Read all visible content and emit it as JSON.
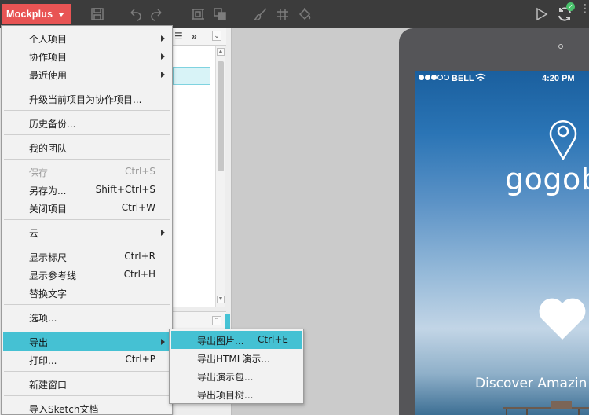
{
  "app": {
    "name": "Mockplus",
    "accent": "#e85454",
    "menu_highlight": "#45c1d3"
  },
  "toolbar": {
    "icons": [
      "save-icon",
      "undo-icon",
      "redo-icon",
      "crop-icon",
      "crop-group-icon",
      "brush-icon",
      "grid-icon",
      "paint-bucket-icon"
    ],
    "right_icons": [
      "play-icon",
      "sync-icon"
    ],
    "sync_badge": "✓"
  },
  "panel": {
    "list_label": "☰",
    "expand_label": "»",
    "collapse": "⌄",
    "scroll_up": "▲",
    "scroll_down": "▼",
    "panel2_arrow": "⌃"
  },
  "menu": {
    "items": [
      {
        "label": "个人项目",
        "shortcut": "",
        "submenu": true,
        "disabled": false
      },
      {
        "label": "协作项目",
        "shortcut": "",
        "submenu": true,
        "disabled": false
      },
      {
        "label": "最近使用",
        "shortcut": "",
        "submenu": true,
        "disabled": false
      },
      {
        "label": "升级当前项目为协作项目...",
        "shortcut": "",
        "submenu": false,
        "disabled": false
      },
      {
        "label": "历史备份...",
        "shortcut": "",
        "submenu": false,
        "disabled": false
      },
      {
        "label": "我的团队",
        "shortcut": "",
        "submenu": false,
        "disabled": false
      },
      {
        "label": "保存",
        "shortcut": "Ctrl+S",
        "submenu": false,
        "disabled": true
      },
      {
        "label": "另存为...",
        "shortcut": "Shift+Ctrl+S",
        "submenu": false,
        "disabled": false
      },
      {
        "label": "关闭项目",
        "shortcut": "Ctrl+W",
        "submenu": false,
        "disabled": false
      },
      {
        "label": "云",
        "shortcut": "",
        "submenu": true,
        "disabled": false
      },
      {
        "label": "显示标尺",
        "shortcut": "Ctrl+R",
        "submenu": false,
        "disabled": false
      },
      {
        "label": "显示参考线",
        "shortcut": "Ctrl+H",
        "submenu": false,
        "disabled": false
      },
      {
        "label": "替换文字",
        "shortcut": "",
        "submenu": false,
        "disabled": false
      },
      {
        "label": "选项...",
        "shortcut": "",
        "submenu": false,
        "disabled": false
      },
      {
        "label": "导出",
        "shortcut": "",
        "submenu": true,
        "disabled": false,
        "active": true
      },
      {
        "label": "打印...",
        "shortcut": "Ctrl+P",
        "submenu": false,
        "disabled": false
      },
      {
        "label": "新建窗口",
        "shortcut": "",
        "submenu": false,
        "disabled": false
      },
      {
        "label": "导入Sketch文档",
        "shortcut": "",
        "submenu": false,
        "disabled": false
      }
    ]
  },
  "export_submenu": {
    "items": [
      {
        "label": "导出图片...",
        "shortcut": "Ctrl+E",
        "active": true
      },
      {
        "label": "导出HTML演示...",
        "shortcut": ""
      },
      {
        "label": "导出演示包...",
        "shortcut": ""
      },
      {
        "label": "导出项目树...",
        "shortcut": ""
      }
    ]
  },
  "device": {
    "status_carrier": "BELL",
    "status_time": "4:20 PM",
    "brand": "gogob",
    "tagline": "Discover Amazin"
  }
}
